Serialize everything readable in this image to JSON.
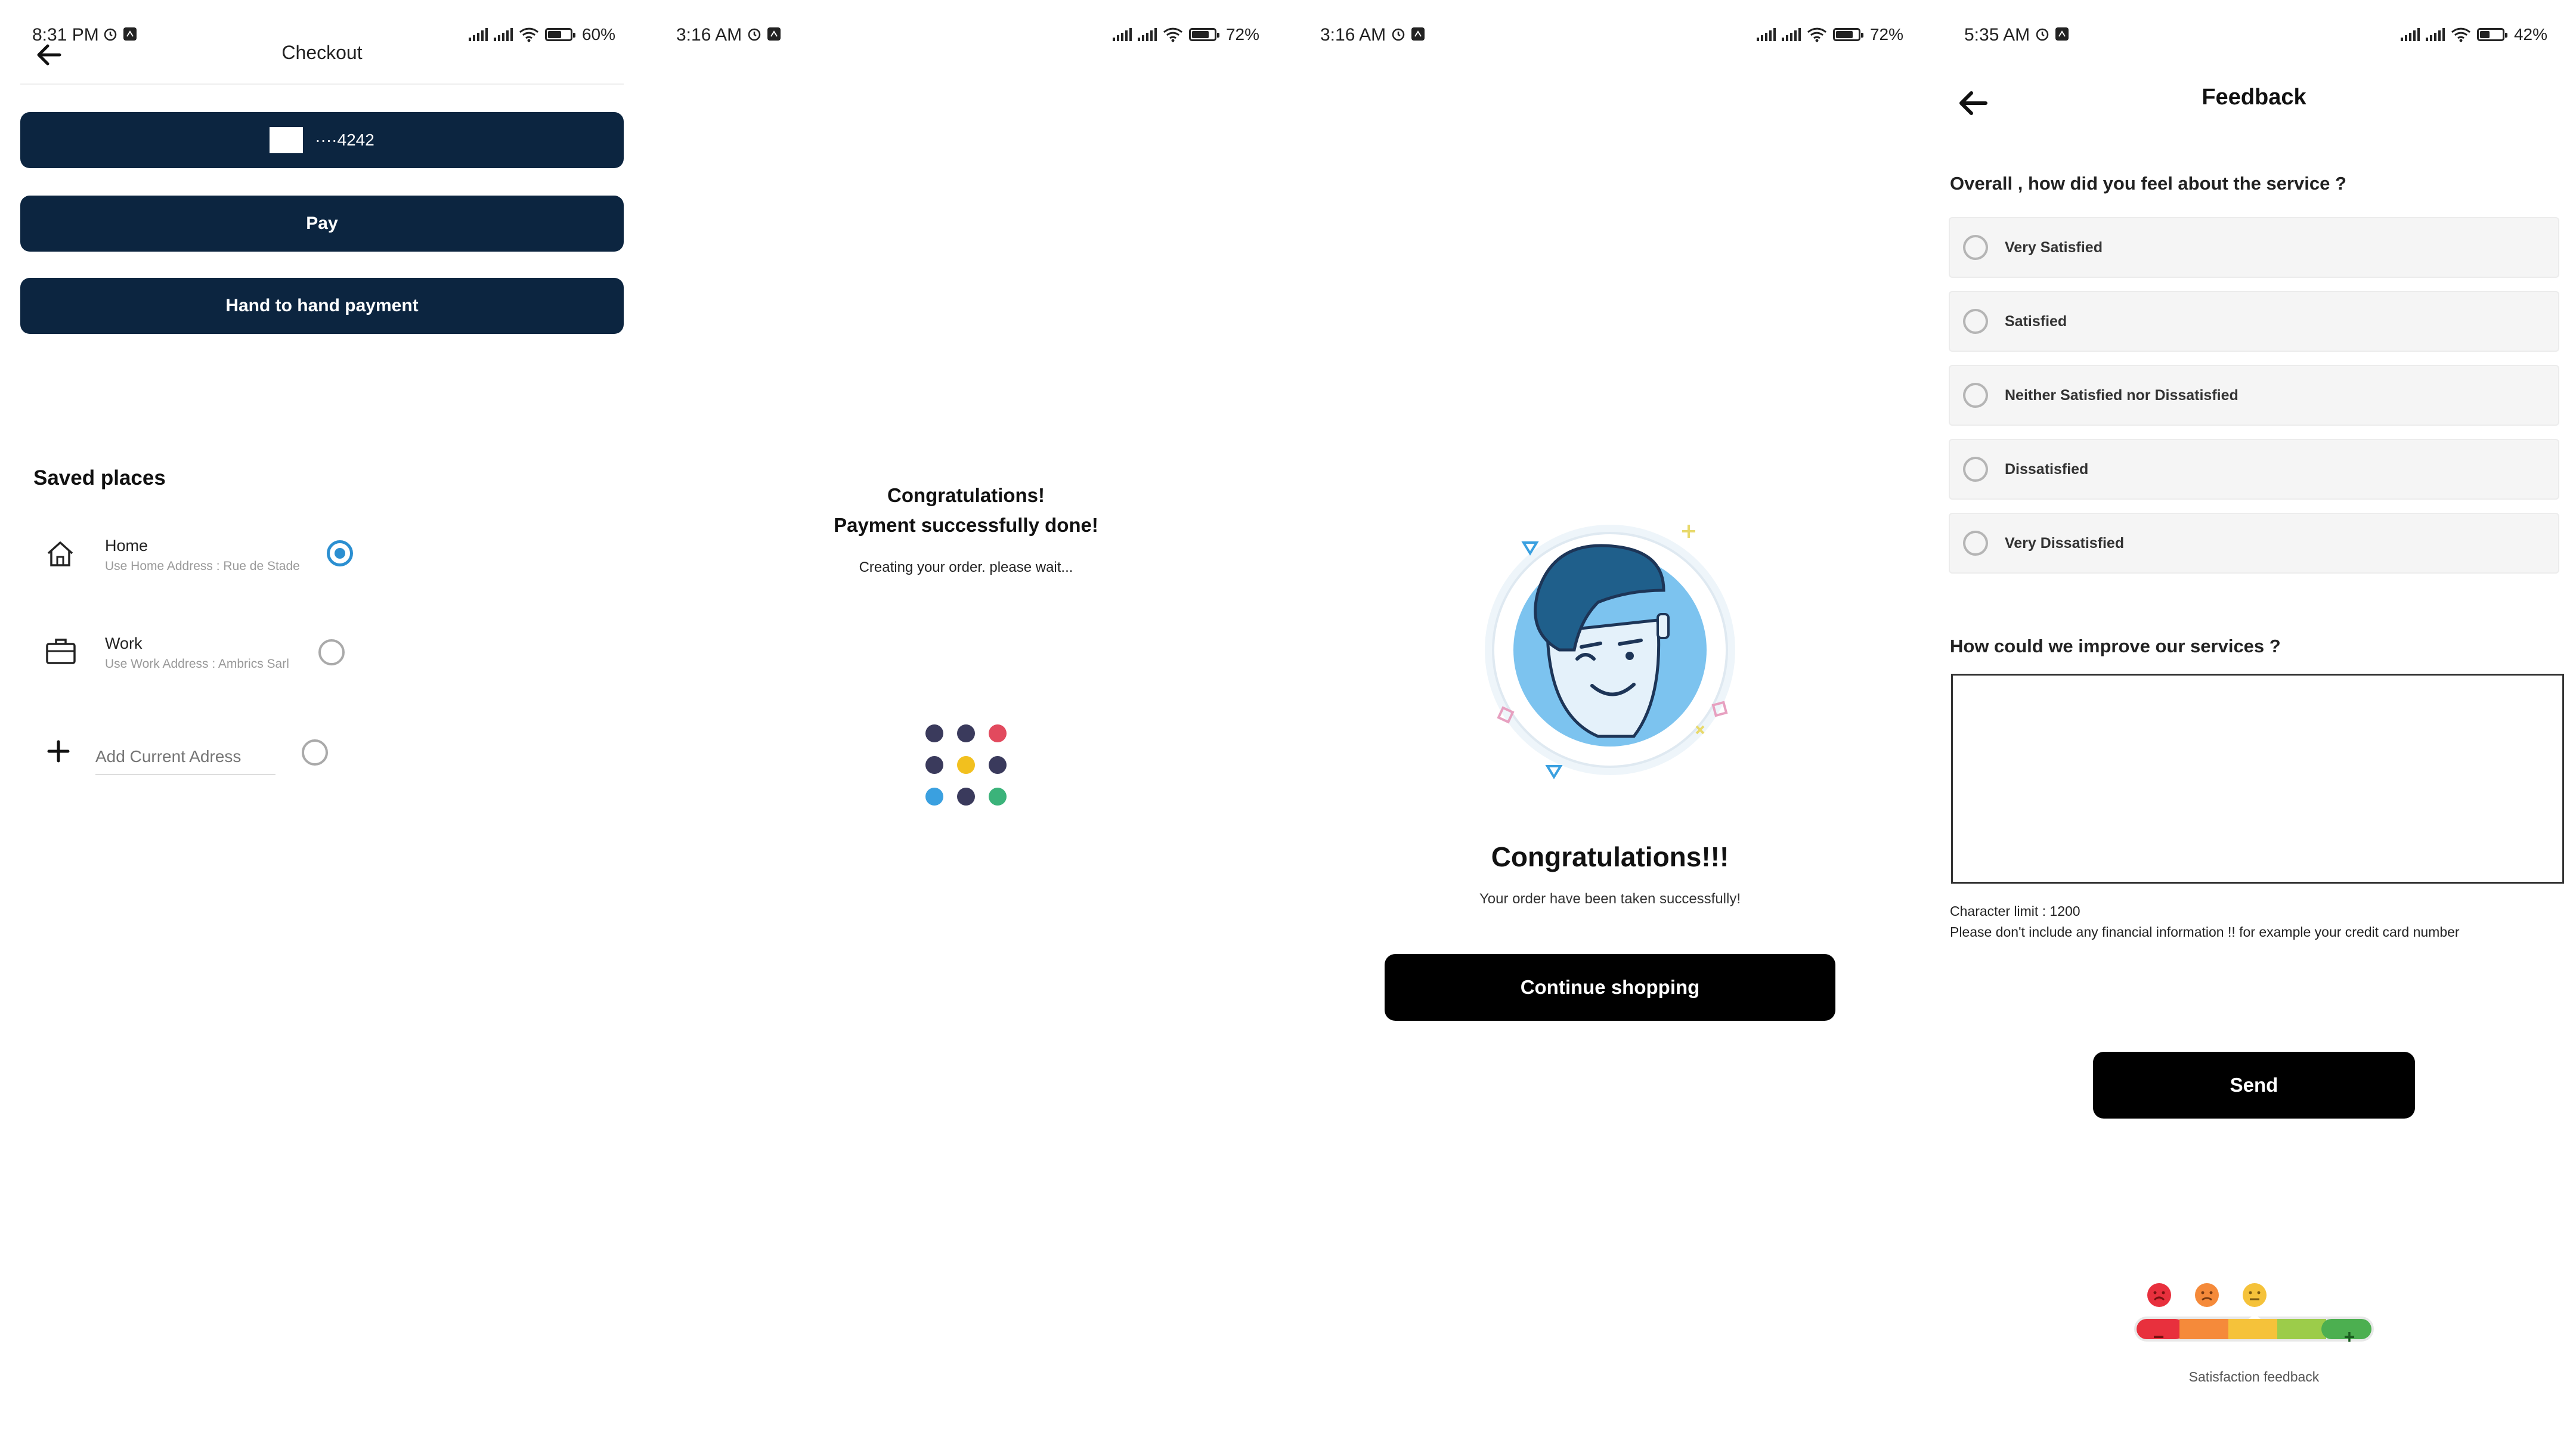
{
  "screens": {
    "checkout": {
      "status": {
        "time": "8:31 PM",
        "battery": "60%"
      },
      "title": "Checkout",
      "card_label": "····4242",
      "pay_label": "Pay",
      "hand_payment_label": "Hand to hand payment",
      "saved_places_title": "Saved places",
      "places": [
        {
          "name": "Home",
          "address": "Use Home Address : Rue de Stade",
          "selected": true
        },
        {
          "name": "Work",
          "address": "Use Work Address : Ambrics Sarl",
          "selected": false
        }
      ],
      "add_current_placeholder": "Add Current Adress"
    },
    "processing": {
      "status": {
        "time": "3:16 AM",
        "battery": "72%"
      },
      "line1": "Congratulations!",
      "line2": "Payment successfully done!",
      "subtitle": "Creating your order. please wait..."
    },
    "success": {
      "status": {
        "time": "3:16 AM",
        "battery": "72%"
      },
      "title": "Congratulations!!!",
      "subtitle": "Your order have been taken successfully!",
      "button_label": "Continue shopping"
    },
    "feedback": {
      "status": {
        "time": "5:35 AM",
        "battery": "42%"
      },
      "title": "Feedback",
      "question1": "Overall , how did you feel about the service ?",
      "options": [
        "Very Satisfied",
        "Satisfied",
        "Neither Satisfied nor Dissatisfied",
        "Dissatisfied",
        "Very Dissatisfied"
      ],
      "question2": "How could we improve our services ?",
      "char_limit": "Character limit : 1200",
      "warning": "Please don't include any financial information !! for example your credit card number",
      "send_label": "Send",
      "meter_caption": "Satisfaction feedback",
      "meter_minus": "−",
      "meter_plus": "+"
    }
  },
  "colors": {
    "navy": "#0c2540",
    "radio_blue": "#2b8fd1",
    "dot_navy": "#3a3a5c",
    "dot_red": "#e24a5e",
    "dot_yellow": "#f2c01e",
    "dot_blue": "#3aa0e0",
    "dot_green": "#3bb37a"
  },
  "icons": [
    "back-arrow-icon",
    "home-icon",
    "briefcase-icon",
    "plus-icon",
    "alarm-icon",
    "signal-icon",
    "wifi-icon",
    "battery-icon"
  ]
}
